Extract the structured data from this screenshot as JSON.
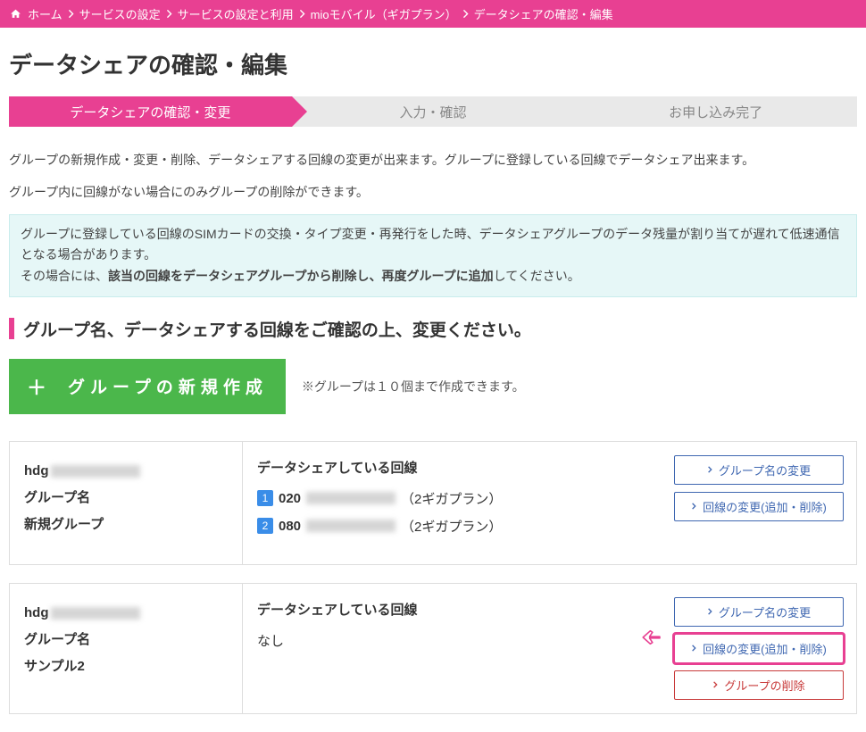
{
  "breadcrumb": {
    "items": [
      {
        "label": "ホーム"
      },
      {
        "label": "サービスの設定"
      },
      {
        "label": "サービスの設定と利用"
      },
      {
        "label": "mioモバイル（ギガプラン）"
      },
      {
        "label": "データシェアの確認・編集"
      }
    ]
  },
  "page_title": "データシェアの確認・編集",
  "wizard": {
    "steps": [
      "データシェアの確認・変更",
      "入力・確認",
      "お申し込み完了"
    ]
  },
  "intro": {
    "p1": "グループの新規作成・変更・削除、データシェアする回線の変更が出来ます。グループに登録している回線でデータシェア出来ます。",
    "p2": "グループ内に回線がない場合にのみグループの削除ができます。"
  },
  "info": {
    "line1": "グループに登録している回線のSIMカードの交換・タイプ変更・再発行をした時、データシェアグループのデータ残量が割り当てが遅れて低速通信となる場合があります。",
    "line2_pre": "その場合には、",
    "line2_b": "該当の回線をデータシェアグループから削除し、再度グループに追加",
    "line2_post": "してください。"
  },
  "section_head": "グループ名、データシェアする回線をご確認の上、変更ください。",
  "create": {
    "plus": "＋",
    "btn_label": "グループの新規作成",
    "note": "※グループは１０個まで作成できます。"
  },
  "groups": [
    {
      "hdg_prefix": "hdg",
      "label_title": "グループ名",
      "name": "新規グループ",
      "share_title": "データシェアしている回線",
      "lines": [
        {
          "num": "1",
          "prefix": "020",
          "plan": "（2ギガプラン）"
        },
        {
          "num": "2",
          "prefix": "080",
          "plan": "（2ギガプラン）"
        }
      ],
      "actions": {
        "rename": "グループ名の変更",
        "change_lines": "回線の変更(追加・削除)"
      }
    },
    {
      "hdg_prefix": "hdg",
      "label_title": "グループ名",
      "name": "サンプル2",
      "share_title": "データシェアしている回線",
      "none": "なし",
      "actions": {
        "rename": "グループ名の変更",
        "change_lines": "回線の変更(追加・削除)",
        "delete": "グループの削除"
      }
    }
  ]
}
